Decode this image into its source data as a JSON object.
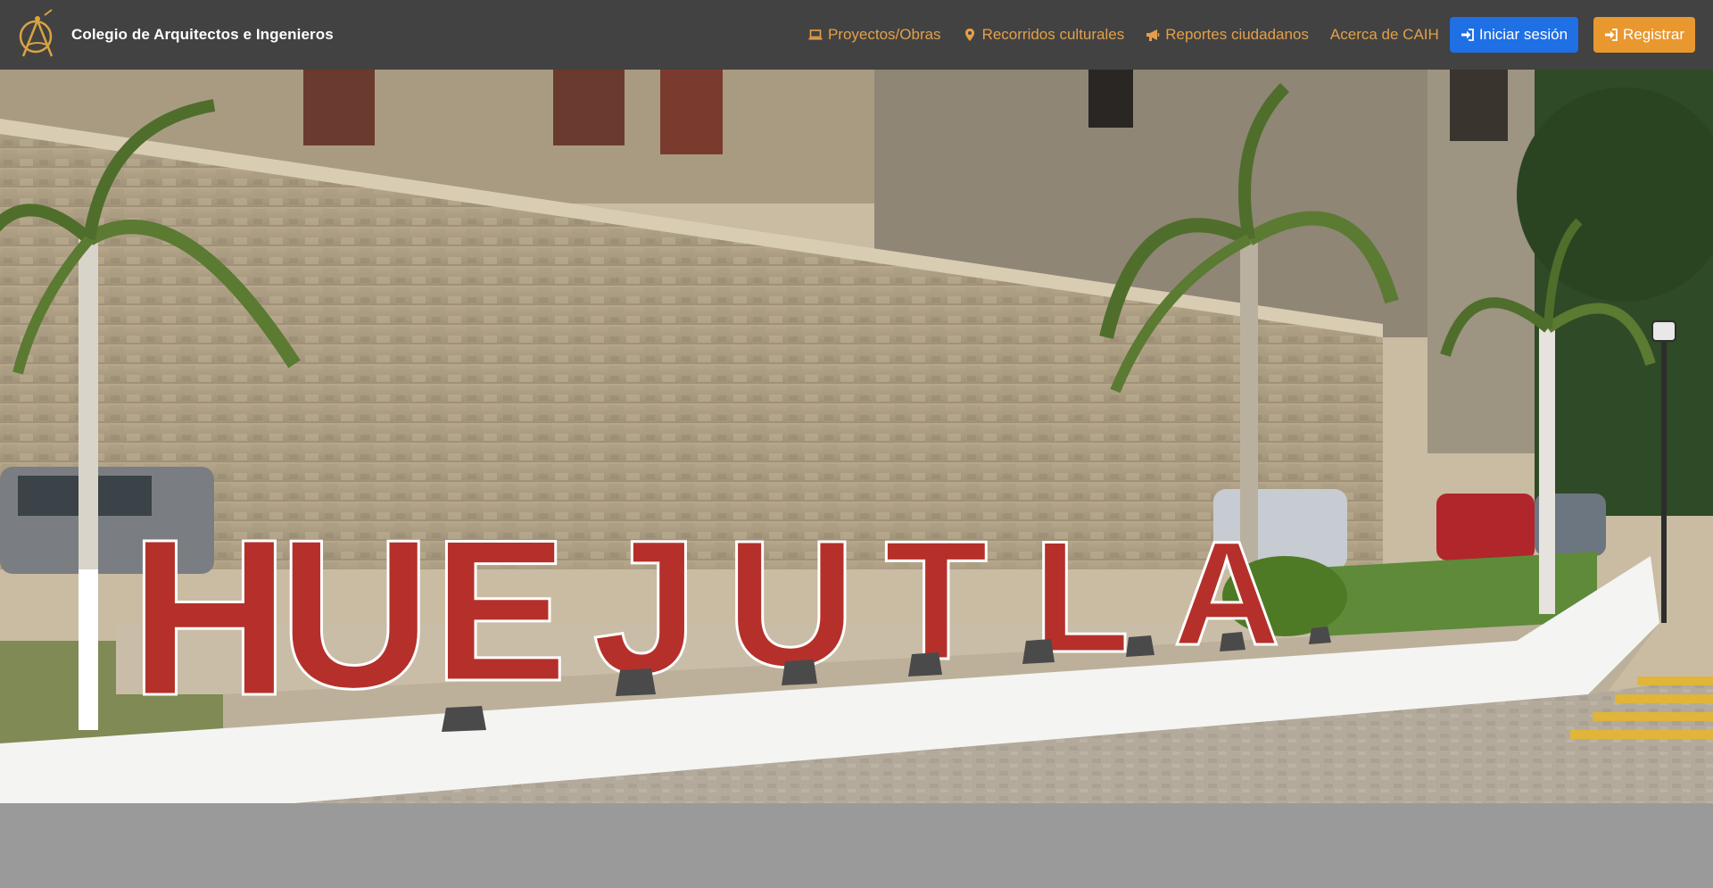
{
  "brand": {
    "name": "Colegio de Arquitectos e Ingenieros",
    "logo_icon": "compass-logo-icon",
    "logo_color": "#d9a43f"
  },
  "nav": {
    "links": [
      {
        "label": "Proyectos/Obras",
        "icon": "laptop-icon"
      },
      {
        "label": "Recorridos culturales",
        "icon": "map-pin-icon"
      },
      {
        "label": "Reportes ciudadanos",
        "icon": "megaphone-icon"
      },
      {
        "label": "Acerca de CAIH"
      }
    ],
    "login_label": "Iniciar sesión",
    "register_label": "Registrar",
    "link_color": "#e3a04a",
    "login_color": "#1f6fe5",
    "register_color": "#e8982f"
  },
  "hero": {
    "sign_text": "HUEJUTLA",
    "sign_color": "#b5302a"
  }
}
